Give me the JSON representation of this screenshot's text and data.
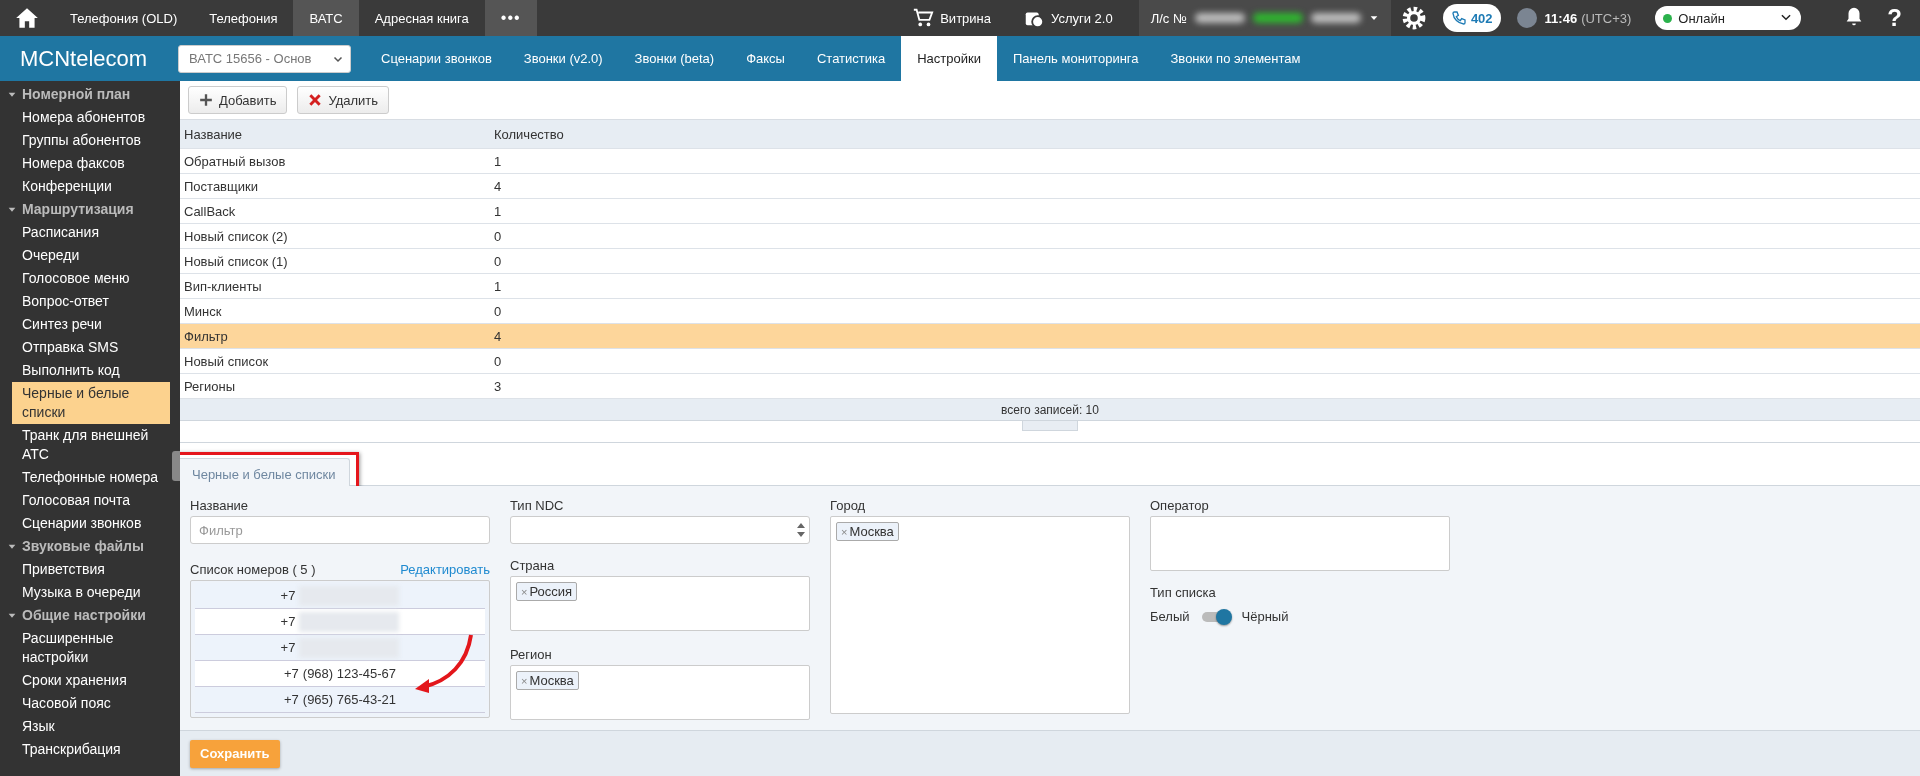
{
  "top_bar": {
    "menu": [
      {
        "label": "Телефония (OLD)",
        "selected": false
      },
      {
        "label": "Телефония",
        "selected": false
      },
      {
        "label": "ВАТС",
        "selected": true
      },
      {
        "label": "Адресная книга",
        "selected": false
      }
    ],
    "more": "•••",
    "showcase": "Витрина",
    "services": "Услуги 2.0",
    "account": {
      "label": "Л/с №",
      "redacted": [
        {
          "color": "#bdbdbd"
        },
        {
          "color": "#2fb52f"
        },
        {
          "color": "#bdbdbd"
        }
      ]
    },
    "calls_badge": "402",
    "time": "11:46",
    "timezone": "(UTC+3)",
    "status": {
      "label": "Онлайн",
      "color": "#2bb24c"
    },
    "help": "?"
  },
  "nav": {
    "logo": "MCNtelecom",
    "pbx_select": "ВАТС 15656 - Основ",
    "tabs": [
      {
        "label": "Сценарии звонков",
        "selected": false
      },
      {
        "label": "Звонки (v2.0)",
        "selected": false
      },
      {
        "label": "Звонки (beta)",
        "selected": false
      },
      {
        "label": "Факсы",
        "selected": false
      },
      {
        "label": "Статистика",
        "selected": false
      },
      {
        "label": "Настройки",
        "selected": true
      },
      {
        "label": "Панель мониторинга",
        "selected": false
      },
      {
        "label": "Звонки по элементам",
        "selected": false
      }
    ]
  },
  "sidebar": [
    {
      "label": "Номерной план",
      "expanded": true,
      "children": [
        {
          "label": "Номера абонентов",
          "selected": false
        },
        {
          "label": "Группы абонентов",
          "selected": false
        },
        {
          "label": "Номера факсов",
          "selected": false
        },
        {
          "label": "Конференции",
          "selected": false
        }
      ]
    },
    {
      "label": "Маршрутизация",
      "expanded": true,
      "children": [
        {
          "label": "Расписания",
          "selected": false
        },
        {
          "label": "Очереди",
          "selected": false
        },
        {
          "label": "Голосовое меню",
          "selected": false
        },
        {
          "label": "Вопрос-ответ",
          "selected": false
        },
        {
          "label": "Синтез речи",
          "selected": false
        },
        {
          "label": "Отправка SMS",
          "selected": false
        },
        {
          "label": "Выполнить код",
          "selected": false
        },
        {
          "label": "Черные и белые списки",
          "selected": true
        },
        {
          "label": "Транк для внешней АТС",
          "selected": false
        },
        {
          "label": "Телефонные номера",
          "selected": false
        },
        {
          "label": "Голосовая почта",
          "selected": false
        },
        {
          "label": "Сценарии звонков",
          "selected": false
        }
      ]
    },
    {
      "label": "Звуковые файлы",
      "expanded": true,
      "children": [
        {
          "label": "Приветствия",
          "selected": false
        },
        {
          "label": "Музыка в очереди",
          "selected": false
        }
      ]
    },
    {
      "label": "Общие настройки",
      "expanded": true,
      "children": [
        {
          "label": "Расширенные настройки",
          "selected": false
        },
        {
          "label": "Сроки хранения",
          "selected": false
        },
        {
          "label": "Часовой пояс",
          "selected": false
        },
        {
          "label": "Язык",
          "selected": false
        },
        {
          "label": "Транскрибация",
          "selected": false
        }
      ]
    }
  ],
  "toolbar": [
    {
      "label": "Добавить",
      "kind": "add"
    },
    {
      "label": "Удалить",
      "kind": "delete"
    }
  ],
  "table": {
    "columns": [
      "Название",
      "Количество"
    ],
    "rows": [
      {
        "cells": [
          "Обратный вызов",
          "1"
        ],
        "selected": false
      },
      {
        "cells": [
          "Поставщики",
          "4"
        ],
        "selected": false
      },
      {
        "cells": [
          "CallBack",
          "1"
        ],
        "selected": false
      },
      {
        "cells": [
          "Новый список (2)",
          "0"
        ],
        "selected": false
      },
      {
        "cells": [
          "Новый список (1)",
          "0"
        ],
        "selected": false
      },
      {
        "cells": [
          "Вип-клиенты",
          "1"
        ],
        "selected": false
      },
      {
        "cells": [
          "Минск",
          "0"
        ],
        "selected": false
      },
      {
        "cells": [
          "Фильтр",
          "4"
        ],
        "selected": true
      },
      {
        "cells": [
          "Новый список",
          "0"
        ],
        "selected": false
      },
      {
        "cells": [
          "Регионы",
          "3"
        ],
        "selected": false
      }
    ],
    "footer": "всего записей: 10"
  },
  "detail_tab": {
    "label": "Черные и белые списки",
    "highlighted": true
  },
  "form": {
    "name": {
      "label": "Название",
      "placeholder": "Фильтр"
    },
    "numbers": {
      "label": "Список номеров ( 5 )",
      "edit_link": "Редактировать",
      "items": [
        {
          "prefix": "+7",
          "marked": false
        },
        {
          "prefix": "+7",
          "marked": false
        },
        {
          "prefix": "+7",
          "marked": false
        },
        {
          "prefix": "+7",
          "number": "(968) 123-45-67",
          "marked": true
        },
        {
          "prefix": "+7",
          "number": "(965) 765-43-21",
          "marked": false
        }
      ]
    },
    "ndc_type": {
      "label": "Тип NDC"
    },
    "country": {
      "label": "Страна",
      "tags": [
        "Россия"
      ]
    },
    "region": {
      "label": "Регион",
      "tags": [
        "Москва"
      ]
    },
    "city": {
      "label": "Город",
      "tags": [
        "Москва"
      ]
    },
    "operator": {
      "label": "Оператор"
    },
    "list_type": {
      "label": "Тип списка",
      "off_label": "Белый",
      "on_label": "Чёрный",
      "on": true
    },
    "tag_remove": "×"
  },
  "save_button": "Сохранить"
}
